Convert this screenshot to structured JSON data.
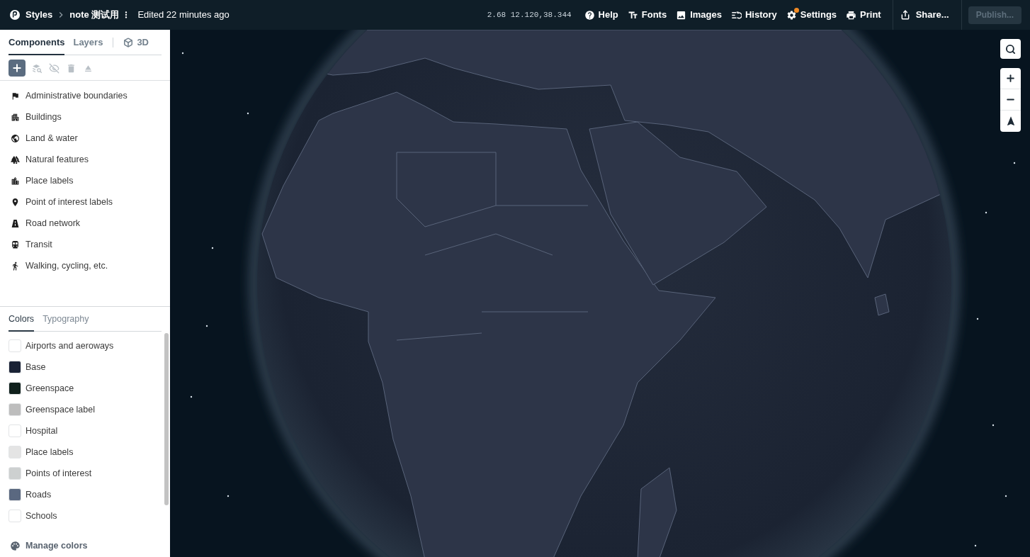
{
  "topbar": {
    "app": "Styles",
    "document": "note 测试用",
    "edited": "Edited 22 minutes ago",
    "coordinates": "2.68 12.120,38.344",
    "actions": [
      {
        "kind": "help",
        "label": "Help",
        "notification": false
      },
      {
        "kind": "fonts",
        "label": "Fonts",
        "notification": false
      },
      {
        "kind": "images",
        "label": "Images",
        "notification": false
      },
      {
        "kind": "history",
        "label": "History",
        "notification": false
      },
      {
        "kind": "settings",
        "label": "Settings",
        "notification": true
      },
      {
        "kind": "print",
        "label": "Print",
        "notification": false
      }
    ],
    "share": "Share...",
    "publish": {
      "label": "Publish...",
      "disabled": true
    }
  },
  "sidebar": {
    "tabs": [
      {
        "label": "Components",
        "selected": true
      },
      {
        "label": "Layers",
        "selected": false
      }
    ],
    "toggle_3d": "3D",
    "tools": [
      {
        "kind": "add",
        "disabled": false
      },
      {
        "kind": "find",
        "disabled": true
      },
      {
        "kind": "hide",
        "disabled": true
      },
      {
        "kind": "delete",
        "disabled": true
      },
      {
        "kind": "eject",
        "disabled": true
      }
    ],
    "components": [
      {
        "kind": "boundaries",
        "label": "Administrative boundaries"
      },
      {
        "kind": "buildings",
        "label": "Buildings"
      },
      {
        "kind": "land",
        "label": "Land & water"
      },
      {
        "kind": "natural",
        "label": "Natural features"
      },
      {
        "kind": "places",
        "label": "Place labels"
      },
      {
        "kind": "poi",
        "label": "Point of interest labels"
      },
      {
        "kind": "roads",
        "label": "Road network"
      },
      {
        "kind": "transit",
        "label": "Transit"
      },
      {
        "kind": "walking",
        "label": "Walking, cycling, etc."
      }
    ]
  },
  "style_panel": {
    "tabs": [
      {
        "label": "Colors",
        "selected": true
      },
      {
        "label": "Typography",
        "selected": false
      }
    ],
    "colors": [
      {
        "label": "Airports and aeroways",
        "color": "#ffffff"
      },
      {
        "label": "Base",
        "color": "#1a2235"
      },
      {
        "label": "Greenspace",
        "color": "#10201c"
      },
      {
        "label": "Greenspace label",
        "color": "#bdbdbd"
      },
      {
        "label": "Hospital",
        "color": "#ffffff"
      },
      {
        "label": "Place labels",
        "color": "#e4e4e4"
      },
      {
        "label": "Points of interest",
        "color": "#cdd0d0"
      },
      {
        "label": "Roads",
        "color": "#5a6880"
      },
      {
        "label": "Schools",
        "color": "#ffffff"
      }
    ],
    "manage_colors": "Manage colors"
  }
}
